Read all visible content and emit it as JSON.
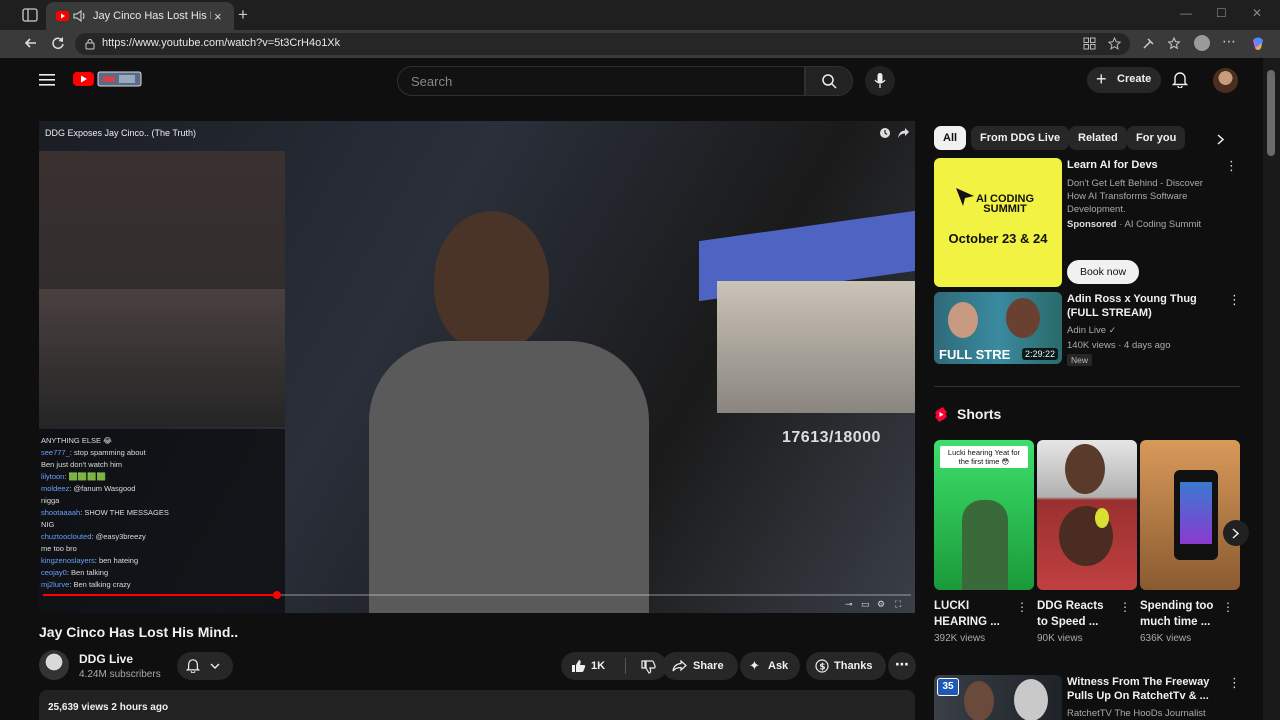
{
  "browser": {
    "tab_title": "Jay Cinco Has Lost His Mind..",
    "tab_close": "×",
    "new_tab": "+",
    "url": "https://www.youtube.com/watch?v=5t3CrH4o1Xk",
    "win_min": "—",
    "win_max": "☐",
    "win_close": "✕"
  },
  "header": {
    "search_placeholder": "Search",
    "create_label": "Create"
  },
  "video": {
    "overlay_title": "DDG Exposes Jay Cinco.. (The Truth)",
    "counter": "17613/18000",
    "progress": 0.27,
    "chat": [
      {
        "user": "",
        "text": "ANYTHING ELSE 😂"
      },
      {
        "user": "see777_",
        "text": ": stop spamming about"
      },
      {
        "user": "",
        "text": "Ben just don't watch him"
      },
      {
        "user": "lilytoon",
        "text": ": 🟩🟩🟩🟩"
      },
      {
        "user": "moldeez",
        "text": ": @fanum Wasgood"
      },
      {
        "user": "",
        "text": "nigga"
      },
      {
        "user": "shootaaaah",
        "text": ": SHOW THE MESSAGES"
      },
      {
        "user": "",
        "text": "NIG"
      },
      {
        "user": "chuztooclouted",
        "text": ": @easy3breezy"
      },
      {
        "user": "",
        "text": "me too bro"
      },
      {
        "user": "kingzenoslayers",
        "text": ": ben hateing"
      },
      {
        "user": "ceojay0",
        "text": ": Ben talking"
      },
      {
        "user": "mj2lurve",
        "text": ": Ben talking crazy"
      }
    ]
  },
  "below": {
    "title": "Jay Cinco Has Lost His Mind..",
    "channel": "DDG Live",
    "subscribers": "4.24M subscribers",
    "likes": "1K",
    "share": "Share",
    "ask": "Ask",
    "thanks": "Thanks",
    "views_line": "25,639 views  2 hours ago"
  },
  "chips": [
    "All",
    "From DDG Live",
    "Related",
    "For you"
  ],
  "ad": {
    "big_text": "AI CODING SUMMIT",
    "date_text": "October 23 & 24",
    "title": "Learn AI for Devs",
    "desc": "Don't Get Left Behind - Discover How AI Transforms Software Development.",
    "sponsored": "Sponsored",
    "advertiser": "· AI Coding Summit",
    "cta": "Book now"
  },
  "rec": {
    "title": "Adin Ross x Young Thug (FULL STREAM)",
    "channel": "Adin Live",
    "meta": "140K views · 4 days ago",
    "badge": "New",
    "duration": "2:29:22",
    "thumb_label": "FULL STRE"
  },
  "shorts": {
    "heading": "Shorts",
    "items": [
      {
        "title": "LUCKI HEARING ...",
        "views": "392K views",
        "caption": "Lucki hearing Yeat for the first time 😳"
      },
      {
        "title": "DDG Reacts to Speed ...",
        "views": "90K views"
      },
      {
        "title": "Spending too much time ...",
        "views": "636K views"
      }
    ]
  },
  "last": {
    "title": "Witness From The Freeway Pulls Up On RatchetTv & ...",
    "channel": "RatchetTV The HooDs Journalist",
    "badge": "35"
  },
  "colors": {
    "accent": "#ff0000",
    "bg": "#0f0f0f",
    "chip_active": "#f1f1f1"
  }
}
